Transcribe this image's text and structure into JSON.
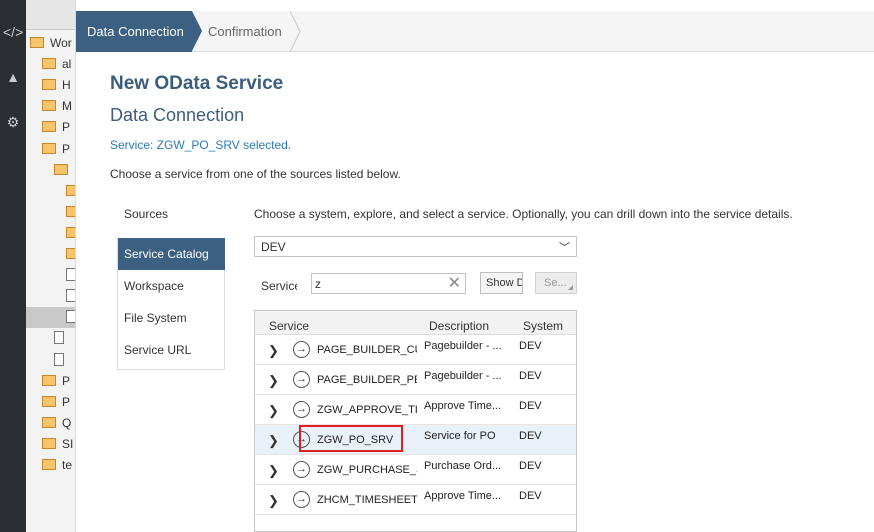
{
  "ide": {
    "rail_icons": [
      "code-icon",
      "graduation-cap-icon",
      "gear-icon"
    ],
    "tree": [
      {
        "label": "Wor",
        "type": "folder",
        "indent": 0
      },
      {
        "label": "al",
        "type": "folder",
        "indent": 1
      },
      {
        "label": "H",
        "type": "folder",
        "indent": 1
      },
      {
        "label": "M",
        "type": "folder",
        "indent": 1
      },
      {
        "label": "P",
        "type": "folder",
        "indent": 1
      },
      {
        "label": "P",
        "type": "folder",
        "indent": 1
      },
      {
        "label": "",
        "type": "folder",
        "indent": 2
      },
      {
        "label": "",
        "type": "folder",
        "indent": 3
      },
      {
        "label": "",
        "type": "folder",
        "indent": 3
      },
      {
        "label": "",
        "type": "folder",
        "indent": 3
      },
      {
        "label": "",
        "type": "folder",
        "indent": 3
      },
      {
        "label": "",
        "type": "file",
        "indent": 3
      },
      {
        "label": "",
        "type": "file",
        "indent": 3
      },
      {
        "label": "",
        "type": "file",
        "indent": 3
      },
      {
        "label": "",
        "type": "file",
        "indent": 2
      },
      {
        "label": "",
        "type": "file",
        "indent": 2
      },
      {
        "label": "P",
        "type": "folder",
        "indent": 1
      },
      {
        "label": "P",
        "type": "folder",
        "indent": 1
      },
      {
        "label": "Q",
        "type": "folder",
        "indent": 1
      },
      {
        "label": "SI",
        "type": "folder",
        "indent": 1
      },
      {
        "label": "te",
        "type": "folder",
        "indent": 1
      }
    ]
  },
  "wizard": {
    "step_active": "Data Connection",
    "step_next": "Confirmation"
  },
  "dialog": {
    "title": "New OData Service",
    "subtitle": "Data Connection",
    "selected_message": "Service: ZGW_PO_SRV selected.",
    "instructions": "Choose a service from one of the sources listed below."
  },
  "sources": {
    "heading": "Sources",
    "items": [
      {
        "label": "Service Catalog",
        "active": true
      },
      {
        "label": "Workspace",
        "active": false
      },
      {
        "label": "File System",
        "active": false
      },
      {
        "label": "Service URL",
        "active": false
      }
    ]
  },
  "catalog": {
    "choose_text": "Choose a system, explore, and select a service. Optionally, you can drill down into the service details.",
    "system_value": "DEV",
    "service_label": "Service",
    "search_value": "z",
    "show_button": "Show Details",
    "select_button": "Se..."
  },
  "table": {
    "headers": {
      "service": "Service",
      "description": "Description",
      "system": "System"
    },
    "rows": [
      {
        "name": "PAGE_BUILDER_CUST",
        "description": "Pagebuilder - ...",
        "system": "DEV",
        "selected": false
      },
      {
        "name": "PAGE_BUILDER_PERS",
        "description": "Pagebuilder - ...",
        "system": "DEV",
        "selected": false
      },
      {
        "name": "ZGW_APPROVE_TIMESHEET",
        "description": "Approve Time...",
        "system": "DEV",
        "selected": false
      },
      {
        "name": "ZGW_PO_SRV",
        "description": "Service for PO",
        "system": "DEV",
        "selected": true
      },
      {
        "name": "ZGW_PURCHASE_SRV",
        "description": "Purchase Ord...",
        "system": "DEV",
        "selected": false
      },
      {
        "name": "ZHCM_TIMESHEET_SRV",
        "description": "Approve Time...",
        "system": "DEV",
        "selected": false
      }
    ]
  },
  "colors": {
    "accent": "#3b6081",
    "title": "#3b5e7e",
    "link": "#2b7bb8",
    "highlight": "#e02020",
    "row_selected": "#e8f1f8"
  }
}
